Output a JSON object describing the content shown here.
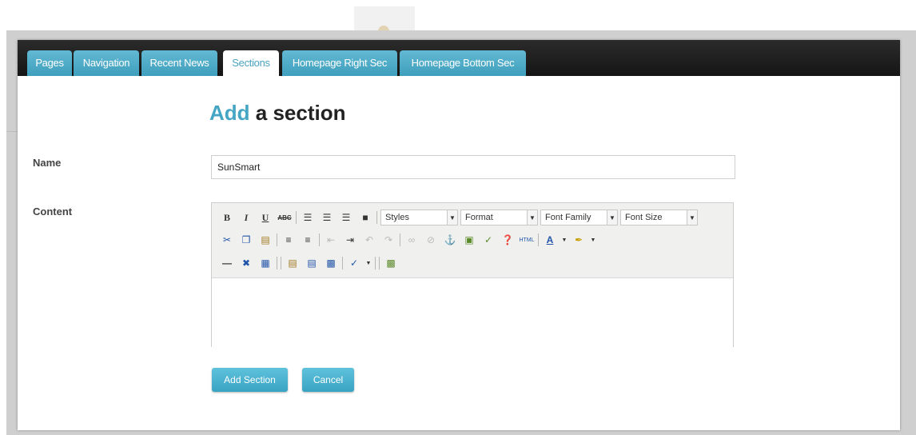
{
  "tabs": [
    "Pages",
    "Navigation",
    "Recent News",
    "Sections",
    "Homepage Right Sec",
    "Homepage Bottom Sec"
  ],
  "active_tab": "Sections",
  "heading": {
    "accent": "Add",
    "rest": " a section"
  },
  "form": {
    "name_label": "Name",
    "name_value": "SunSmart",
    "content_label": "Content"
  },
  "editor": {
    "styles": "Styles",
    "format": "Format",
    "font_family": "Font Family",
    "font_size": "Font Size"
  },
  "buttons": {
    "add": "Add Section",
    "cancel": "Cancel"
  },
  "colors": {
    "accent": "#45a5c4",
    "tab": "#4aaccb",
    "tabbar": "#1f1f1f"
  }
}
